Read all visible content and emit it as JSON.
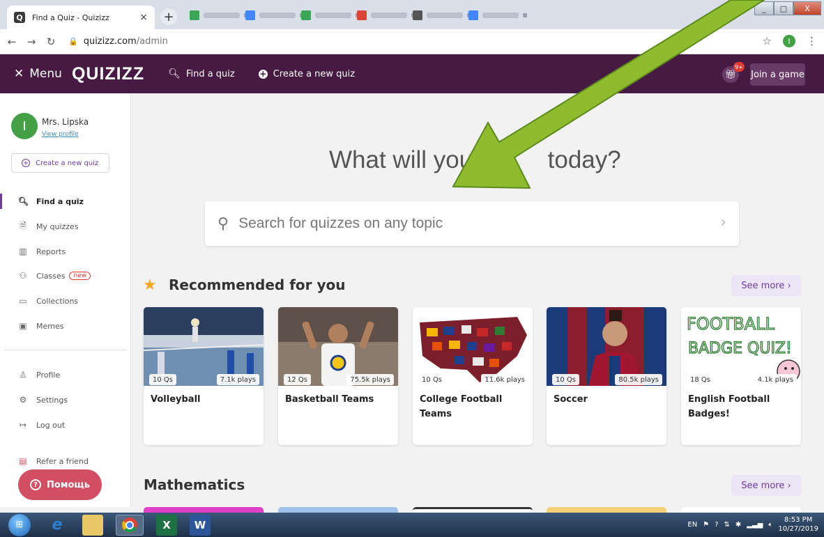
{
  "browser": {
    "tab_title": "Find a Quiz - Quizizz",
    "tab_favicon": "Q",
    "url_host": "quizizz.com",
    "url_path": "/admin",
    "profile_initial": "I"
  },
  "header": {
    "menu_label": "Menu",
    "logo": "QUIZIZZ",
    "find_quiz": "Find a quiz",
    "create_quiz": "Create a new quiz",
    "gift_badge": "9+",
    "join_game": "Join a game"
  },
  "sidebar": {
    "avatar_initial": "I",
    "user_name": "Mrs. Lipska",
    "view_profile": "View profile",
    "create_button": "Create a new quiz",
    "items": [
      {
        "label": "Find a quiz",
        "icon": "search-icon"
      },
      {
        "label": "My quizzes",
        "icon": "document-icon"
      },
      {
        "label": "Reports",
        "icon": "chart-icon"
      },
      {
        "label": "Classes",
        "icon": "classes-icon"
      },
      {
        "label": "Collections",
        "icon": "folder-icon"
      },
      {
        "label": "Memes",
        "icon": "image-icon"
      },
      {
        "label": "Profile",
        "icon": "user-icon"
      },
      {
        "label": "Settings",
        "icon": "gear-icon"
      },
      {
        "label": "Log out",
        "icon": "logout-icon"
      },
      {
        "label": "Refer a friend",
        "icon": "gift-icon"
      }
    ],
    "classes_badge": "new",
    "help_button": "Помощь"
  },
  "main": {
    "hero_left": "What will you t",
    "hero_right": "today?",
    "search_placeholder": "Search for quizzes on any topic",
    "section1_title": "Recommended for you",
    "section2_title": "Mathematics",
    "see_more": "See more",
    "thumb_texts": {
      "football_line1": "FOOTBALL",
      "football_line2": "BADGE QUIZ!"
    },
    "cards": [
      {
        "title": "Volleyball",
        "qs": "10 Qs",
        "plays": "7.1k plays"
      },
      {
        "title": "Basketball Teams",
        "qs": "12 Qs",
        "plays": "75.5k plays"
      },
      {
        "title": "College Football Teams",
        "qs": "10 Qs",
        "plays": "11.6k plays"
      },
      {
        "title": "Soccer",
        "qs": "10 Qs",
        "plays": "80.5k plays"
      },
      {
        "title": "English Football Badges!",
        "qs": "18 Qs",
        "plays": "4.1k plays"
      }
    ]
  },
  "taskbar": {
    "lang": "EN",
    "time": "8:53 PM",
    "date": "10/27/2019"
  }
}
